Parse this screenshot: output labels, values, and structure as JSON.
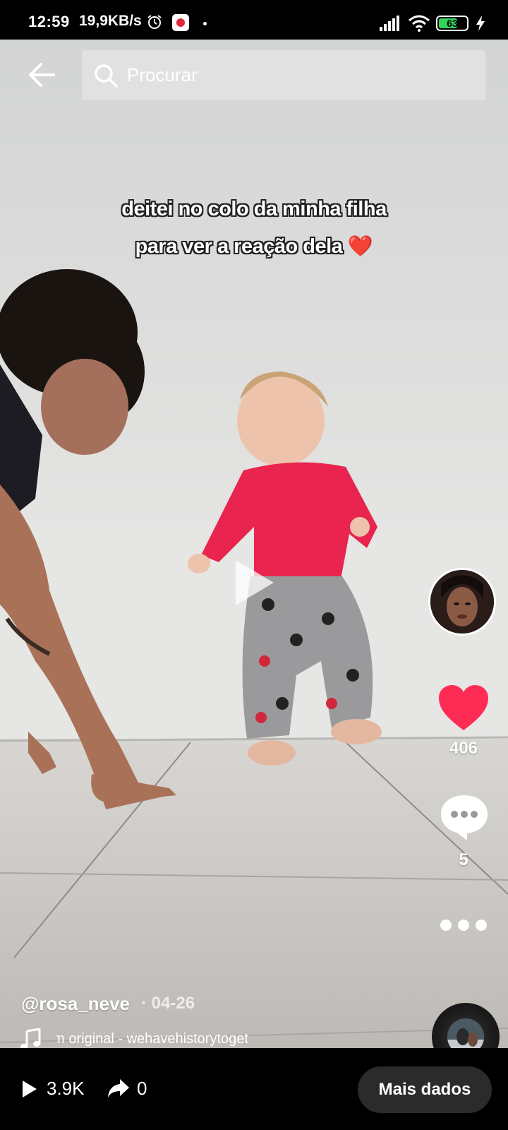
{
  "status_bar": {
    "time": "12:59",
    "speed": "19,9KB/s",
    "battery": "63"
  },
  "search": {
    "placeholder": "Procurar"
  },
  "video": {
    "caption_line1": "deitei no colo da minha filha",
    "caption_line2": "para ver a reação dela",
    "caption_emoji": "❤️"
  },
  "actions": {
    "likes": "406",
    "comments": "5"
  },
  "post": {
    "author": "@rosa_neve",
    "date": "· 04-26",
    "music": "om original - wehavehistorytoget"
  },
  "bottom": {
    "views": "3.9K",
    "shares": "0",
    "more_data_label": "Mais dados"
  },
  "colors": {
    "like": "#fe2c55",
    "battery": "#34d35a",
    "button_bg": "#2b2b2b"
  },
  "icons": [
    "back-arrow-icon",
    "search-icon",
    "play-icon",
    "heart-icon",
    "comment-icon",
    "more-icon",
    "music-note-icon",
    "views-play-icon",
    "share-icon"
  ]
}
